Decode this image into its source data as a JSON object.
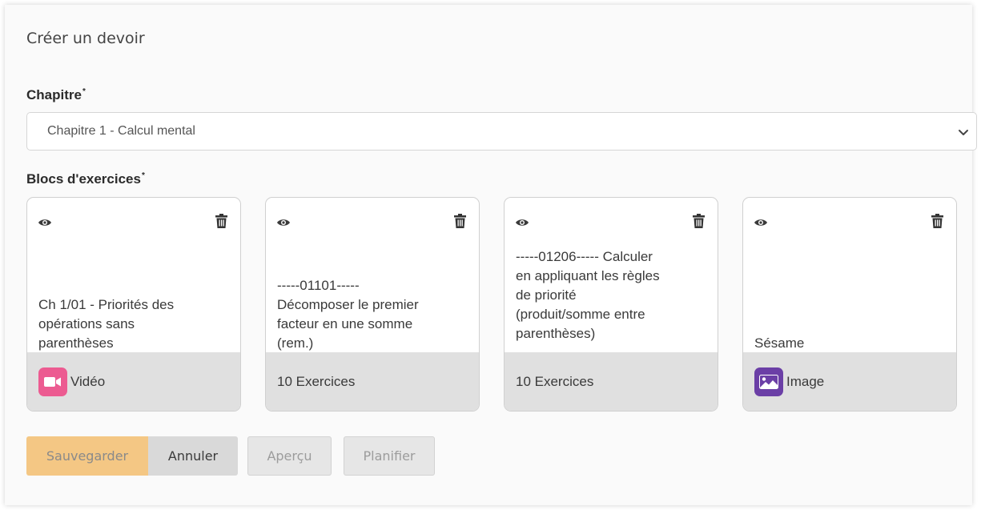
{
  "page": {
    "title": "Créer un devoir"
  },
  "chapter": {
    "label": "Chapitre",
    "required_mark": "*",
    "selected": "Chapitre 1 - Calcul mental"
  },
  "blocks": {
    "label": "Blocs d'exercices",
    "required_mark": "*",
    "items": [
      {
        "lines": [
          "Ch 1/01 - Priorités des",
          "opérations sans",
          "parenthèses"
        ],
        "footer": "Vidéo",
        "media": "video-icon",
        "media_color": "#ec5b91"
      },
      {
        "lines": [
          "-----01101-----",
          "Décomposer le premier",
          "facteur en une somme",
          "(rem.)"
        ],
        "footer": "10 Exercices"
      },
      {
        "lines": [
          "-----01206----- Calculer",
          "en appliquant les règles",
          "de priorité",
          "(produit/somme entre",
          "parenthèses)"
        ],
        "footer": "10 Exercices"
      },
      {
        "lines": [
          "Sésame"
        ],
        "footer": "Image",
        "media": "image-icon",
        "media_color": "#6b3fa6"
      }
    ]
  },
  "actions": {
    "save": "Sauvegarder",
    "cancel": "Annuler",
    "preview": "Aperçu",
    "plan": "Planifier"
  },
  "colors": {
    "save_button": "#f4c784",
    "footer_background": "#e0e0e0"
  }
}
